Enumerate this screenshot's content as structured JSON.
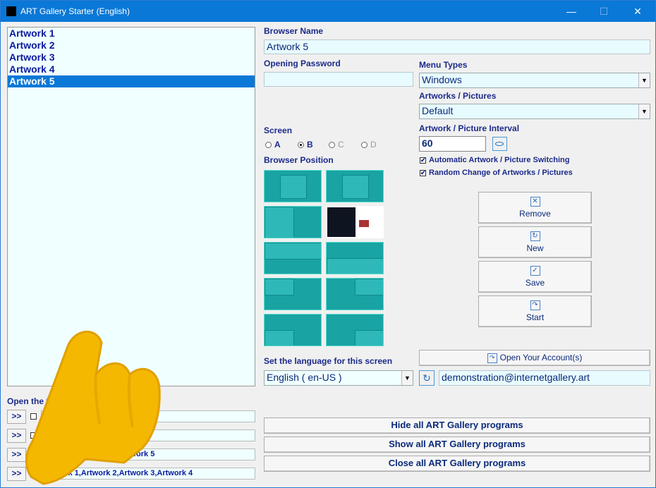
{
  "window": {
    "title": "ART Gallery Starter (English)",
    "minimize": "—",
    "maximize": "☐",
    "close": "✕"
  },
  "artworks": [
    "Artwork 1",
    "Artwork 2",
    "Artwork 3",
    "Artwork 4",
    "Artwork 5"
  ],
  "selected_index": 4,
  "browser_name": {
    "label": "Browser Name",
    "value": "Artwork 5"
  },
  "opening_password": {
    "label": "Opening Password",
    "value": ""
  },
  "menu_types": {
    "label": "Menu Types",
    "value": "Windows"
  },
  "artworks_pictures": {
    "label": "Artworks / Pictures",
    "value": "Default"
  },
  "screen": {
    "label": "Screen",
    "options": [
      "A",
      "B",
      "C",
      "D"
    ],
    "selected": "B"
  },
  "interval": {
    "label": "Artwork / Picture Interval",
    "value": "60"
  },
  "auto_switch": {
    "label": "Automatic Artwork / Picture Switching",
    "checked": true
  },
  "random_change": {
    "label": "Random Change of Artworks / Pictures",
    "checked": true
  },
  "browser_position": {
    "label": "Browser Position"
  },
  "actions": {
    "remove": "Remove",
    "new": "New",
    "save": "Save",
    "start": "Start"
  },
  "language": {
    "label": "Set the language for this screen",
    "value": "English ( en-US )"
  },
  "account": {
    "button": "Open Your Account(s)",
    "email": "demonstration@internetgallery.art"
  },
  "open_programs": {
    "label": "Open the following programs :",
    "rows": [
      {
        "button": ">>",
        "checked": false,
        "value": "Artwork 1"
      },
      {
        "button": ">>",
        "checked": false,
        "value": "Artwork 1,Artwork 5"
      },
      {
        "button": ">>",
        "checked": false,
        "value": "Artwork 1,Artwork 2,Artwork 5"
      },
      {
        "button": ">>",
        "checked": true,
        "value": "Artwork 1,Artwork 2,Artwork 3,Artwork 4"
      }
    ]
  },
  "program_buttons": {
    "hide": "Hide all ART Gallery programs",
    "show": "Show all ART Gallery programs",
    "close": "Close all ART Gallery programs"
  },
  "colors": {
    "accent": "#0a78d7",
    "thumb": "#1aa3a3",
    "hand": "#f5b800"
  }
}
